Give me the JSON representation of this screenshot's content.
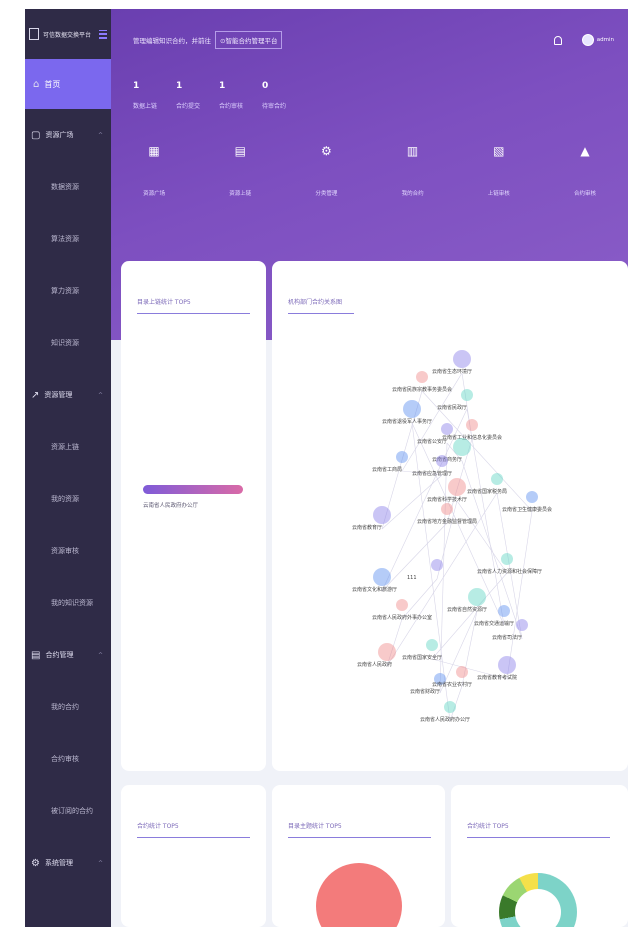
{
  "brand": {
    "name": "可信数据交换平台"
  },
  "sidebar": {
    "home": "首页",
    "groups": [
      {
        "label": "资源广场",
        "icon": "square-icon",
        "items": [
          "数据资源",
          "算法资源",
          "算力资源",
          "知识资源"
        ]
      },
      {
        "label": "资源管理",
        "icon": "chart-icon",
        "items": [
          "资源上链",
          "我的资源",
          "资源审核",
          "我的知识资源"
        ]
      },
      {
        "label": "合约管理",
        "icon": "document-icon",
        "items": [
          "我的合约",
          "合约审核",
          "被订阅的合约"
        ]
      },
      {
        "label": "系统管理",
        "icon": "gear-icon",
        "items": []
      }
    ]
  },
  "header": {
    "welcome": "管理编辑知识合约，并前往",
    "platform_button": "智能合约管理平台",
    "user": "admin"
  },
  "stats": [
    {
      "value": "1",
      "label": "数据上链"
    },
    {
      "value": "1",
      "label": "合约提交"
    },
    {
      "value": "1",
      "label": "合约审核"
    },
    {
      "value": "0",
      "label": "待审合约"
    }
  ],
  "quick_links": [
    {
      "label": "资源广场",
      "icon": "building-icon"
    },
    {
      "label": "资源上链",
      "icon": "file-icon"
    },
    {
      "label": "分类管理",
      "icon": "gear-icon"
    },
    {
      "label": "我的合约",
      "icon": "contract-icon"
    },
    {
      "label": "上链审核",
      "icon": "audit-icon"
    },
    {
      "label": "合约审核",
      "icon": "stamp-icon"
    }
  ],
  "panels": {
    "top5": "目录上链统计 TOP5",
    "graph": "机构部门合约关系图",
    "contract_top5": "合约统计 TOP5",
    "topic_top5": "目录主题统计 TOP5",
    "contract_top5_b": "合约统计 TOP5"
  },
  "top5_chart": {
    "type": "bar",
    "categories": [
      "云南省人民政府办公厅"
    ],
    "values": [
      1
    ]
  },
  "graph_nodes": [
    "云南省生态环境厅",
    "云南省民族宗教事务委员会",
    "云南省民政厅",
    "云南省退役军人事务厅",
    "云南省公安厅",
    "云南省工业和信息化委员会",
    "云南省商务厅",
    "云南省工商局",
    "云南省应急管理厅",
    "云南省科学技术厅",
    "云南省国家税务局",
    "云南省卫生健康委员会",
    "云南省教育厅",
    "云南省地方金融监督管理局",
    "云南省人力资源和社会保障厅",
    "云南省文化和旅游厅",
    "111",
    "云南省人民政府外事办公室",
    "云南省自然资源厅",
    "云南省交通运输厅",
    "云南省司法厅",
    "云南省人民政府",
    "云南省国家安全厅",
    "云南省财政厅",
    "云南省教育考试院",
    "云南省农业农村厅",
    "云南省人民政府办公厅"
  ],
  "colors": {
    "accent": "#7b68ee",
    "sidebar": "#2f2b47",
    "pie": "#f37b7b",
    "donut1": "#7dd3c8",
    "donut2": "#f5e04a",
    "donut3": "#3a7a2a"
  }
}
